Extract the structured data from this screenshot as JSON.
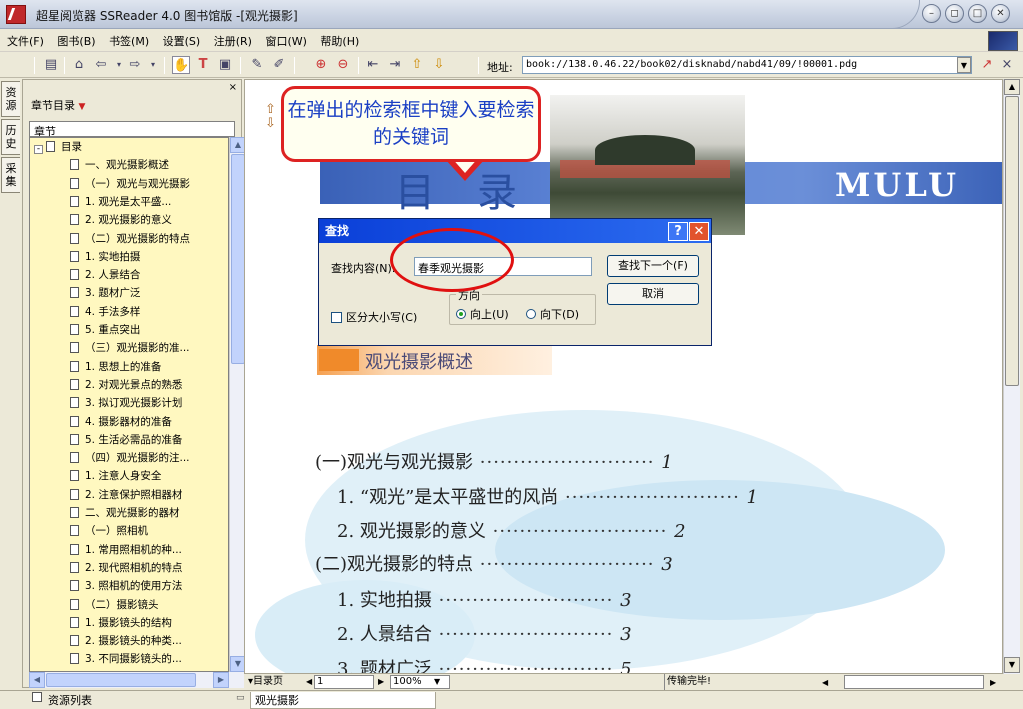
{
  "window": {
    "title": "超星阅览器 SSReader 4.0 图书馆版 -[观光摄影]",
    "buttons": {
      "minimize": "–",
      "restore": "◻",
      "maximize": "□",
      "close": "✕"
    }
  },
  "menu": [
    "文件(F)",
    "图书(B)",
    "书签(M)",
    "设置(S)",
    "注册(R)",
    "窗口(W)",
    "帮助(H)"
  ],
  "toolbar": {
    "address_label": "地址:",
    "address_value": "book://138.0.46.22/book02/disknabd/nabd41/09/!00001.pdg"
  },
  "vertical_tabs": [
    "资源",
    "历史",
    "采集"
  ],
  "sidebar": {
    "close": "×",
    "header": "章节目录",
    "column_header": "章节",
    "tree": [
      {
        "label": "目录",
        "level": 0,
        "expander": "-"
      },
      {
        "label": "一、观光摄影概述",
        "level": 1
      },
      {
        "label": "（一）观光与观光摄影",
        "level": 1
      },
      {
        "label": "1. 观光是太平盛...",
        "level": 1
      },
      {
        "label": "2. 观光摄影的意义",
        "level": 1
      },
      {
        "label": "（二）观光摄影的特点",
        "level": 1
      },
      {
        "label": "1. 实地拍摄",
        "level": 1
      },
      {
        "label": "2. 人景结合",
        "level": 1
      },
      {
        "label": "3. 题材广泛",
        "level": 1
      },
      {
        "label": "4. 手法多样",
        "level": 1
      },
      {
        "label": "5. 重点突出",
        "level": 1
      },
      {
        "label": "（三）观光摄影的准...",
        "level": 1
      },
      {
        "label": "1. 思想上的准备",
        "level": 1
      },
      {
        "label": "2. 对观光景点的熟悉",
        "level": 1
      },
      {
        "label": "3. 拟订观光摄影计划",
        "level": 1
      },
      {
        "label": "4. 摄影器材的准备",
        "level": 1
      },
      {
        "label": "5. 生活必需品的准备",
        "level": 1
      },
      {
        "label": "（四）观光摄影的注...",
        "level": 1
      },
      {
        "label": "1. 注意人身安全",
        "level": 1
      },
      {
        "label": "2. 注意保护照相器材",
        "level": 1
      },
      {
        "label": "二、观光摄影的器材",
        "level": 1
      },
      {
        "label": "（一）照相机",
        "level": 1
      },
      {
        "label": "1. 常用照相机的种...",
        "level": 1
      },
      {
        "label": "2. 现代照相机的特点",
        "level": 1
      },
      {
        "label": "3. 照相机的使用方法",
        "level": 1
      },
      {
        "label": "（二）摄影镜头",
        "level": 1
      },
      {
        "label": "1. 摄影镜头的结构",
        "level": 1
      },
      {
        "label": "2. 摄影镜头的种类...",
        "level": 1
      },
      {
        "label": "3. 不同摄影镜头的...",
        "level": 1
      }
    ]
  },
  "page": {
    "callout": "在弹出的检索框中键入要检索的关键词",
    "banner_title": "目录",
    "banner_en": "MULU",
    "section_title": "观光摄影概述",
    "toc": [
      {
        "text": "(一)观光与观光摄影",
        "page": "1"
      },
      {
        "text": "1. “观光”是太平盛世的风尚",
        "page": "1"
      },
      {
        "text": "2. 观光摄影的意义",
        "page": "2"
      },
      {
        "text": "(二)观光摄影的特点",
        "page": "3"
      },
      {
        "text": "1. 实地拍摄",
        "page": "3"
      },
      {
        "text": "2. 人景结合",
        "page": "3"
      },
      {
        "text": "3. 题材广泛",
        "page": "5"
      }
    ]
  },
  "find_dialog": {
    "title": "查找",
    "help": "?",
    "close": "✕",
    "find_label": "查找内容(N):",
    "find_value": "春季观光摄影",
    "find_next": "查找下一个(F)",
    "cancel": "取消",
    "match_case": "区分大小写(C)",
    "direction_label": "方向",
    "dir_up": "向上(U)",
    "dir_down": "向下(D)"
  },
  "status": {
    "toc_page": "▾目录页",
    "page_number": "1",
    "zoom": "100%",
    "transfer": "传输完毕!"
  },
  "bottom": {
    "resource_list": "资源列表",
    "doc_tab": "观光摄影"
  }
}
